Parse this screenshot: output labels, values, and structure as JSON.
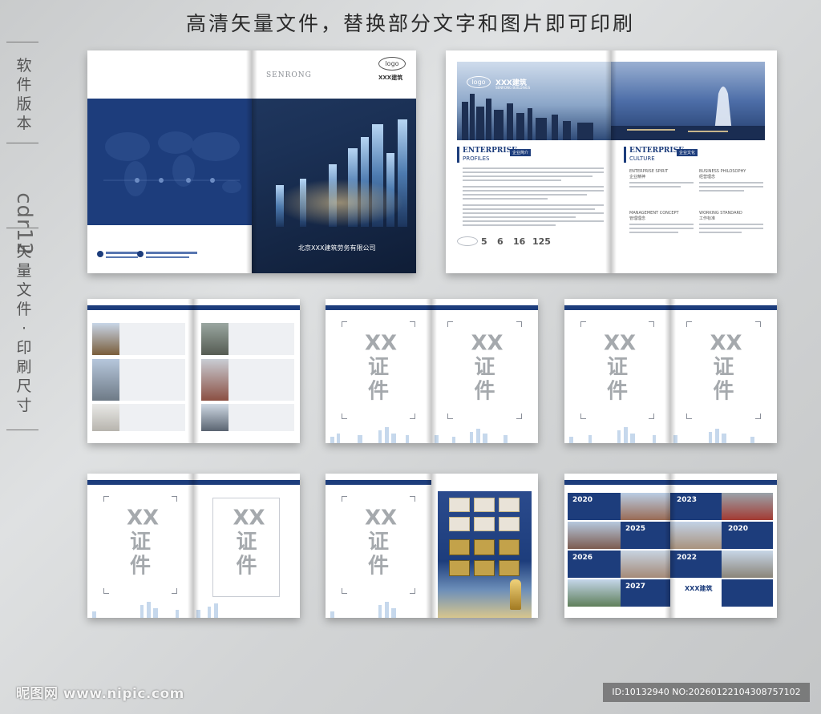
{
  "headline": "高清矢量文件，替换部分文字和图片即可印刷",
  "side": {
    "label_top": "软件版本",
    "software": "cdr12",
    "label_bottom": "矢量文件·印刷尺寸"
  },
  "cover": {
    "brand_en": "SENRONG",
    "logo": "logo",
    "company_short": "XXX建筑",
    "company_full": "北京XXX建筑劳务有限公司"
  },
  "profile": {
    "logo": "logo",
    "company": "XXX建筑",
    "company_en": "SENRONG BUILDINGS",
    "left_heading": "ENTERPRISE",
    "left_sub": "PROFILES",
    "left_tag": "企业简介",
    "right_heading": "ENTERPRISE",
    "right_sub": "CULTURE",
    "right_tag": "企业文化",
    "culture": [
      {
        "en": "ENTERPRISE SPIRIT",
        "cn": "企业精神"
      },
      {
        "en": "BUSINESS PHILOSOPHY",
        "cn": "经营理念"
      },
      {
        "en": "MANAGEMENT CONCEPT",
        "cn": "管理理念"
      },
      {
        "en": "WORKING STANDARD",
        "cn": "工作标准"
      }
    ],
    "stats": [
      "5",
      "6",
      "16",
      "125"
    ]
  },
  "cert": {
    "text": "XX证件"
  },
  "history": {
    "years_left": [
      "2020",
      "2025",
      "2026",
      "2027"
    ],
    "years_right": [
      "2023",
      "2020",
      "2022"
    ],
    "company": "XXX建筑"
  },
  "footer": {
    "brand": "昵图网 www.nipic.com",
    "id": "ID:10132940 NO:20260122104308757102"
  },
  "colors": {
    "navy": "#1d3d7c",
    "background": "#d6d8d9"
  }
}
